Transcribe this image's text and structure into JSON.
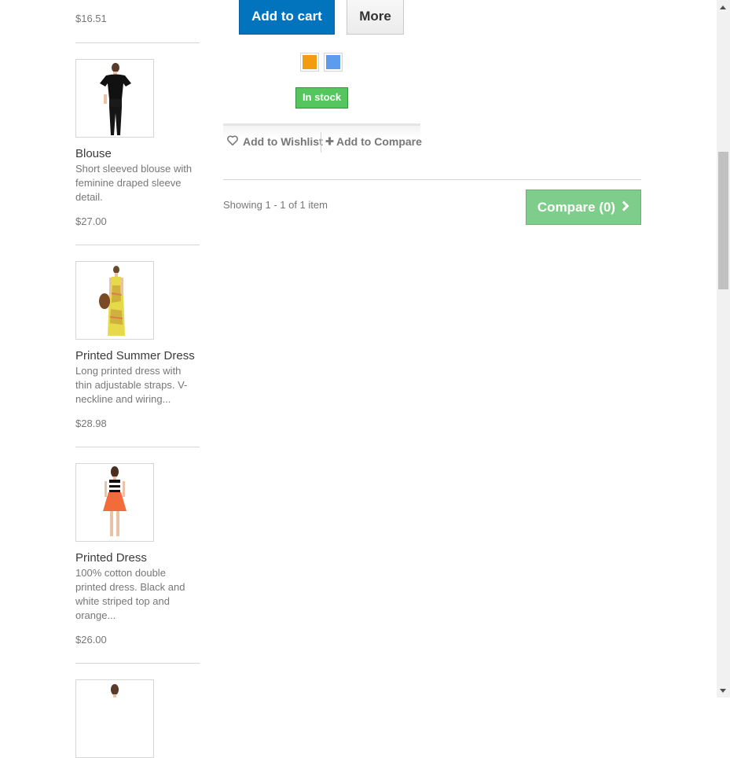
{
  "sidebar": {
    "top_price": "$16.51",
    "items": [
      {
        "name": "Blouse",
        "description": "Short sleeved blouse with feminine draped sleeve detail.",
        "price": "$27.00"
      },
      {
        "name": "Printed Summer Dress",
        "description": "Long printed dress with thin adjustable straps. V-neckline and wiring...",
        "price": "$28.98"
      },
      {
        "name": "Printed Dress",
        "description": "100% cotton double printed dress. Black and white striped top and orange...",
        "price": "$26.00"
      }
    ]
  },
  "product": {
    "add_to_cart": "Add to cart",
    "more": "More",
    "colors": [
      "#f39c11",
      "#5d9cec"
    ],
    "stock": "In stock",
    "wishlist": "Add to Wishlist",
    "compare": "Add to Compare"
  },
  "listing": {
    "showing": "Showing 1 - 1 of 1 item",
    "compare_button": "Compare (0)"
  },
  "icons": {
    "wishlist": "heart-icon",
    "compare": "plus-icon",
    "compare_arrow": "chevron-right-icon"
  }
}
